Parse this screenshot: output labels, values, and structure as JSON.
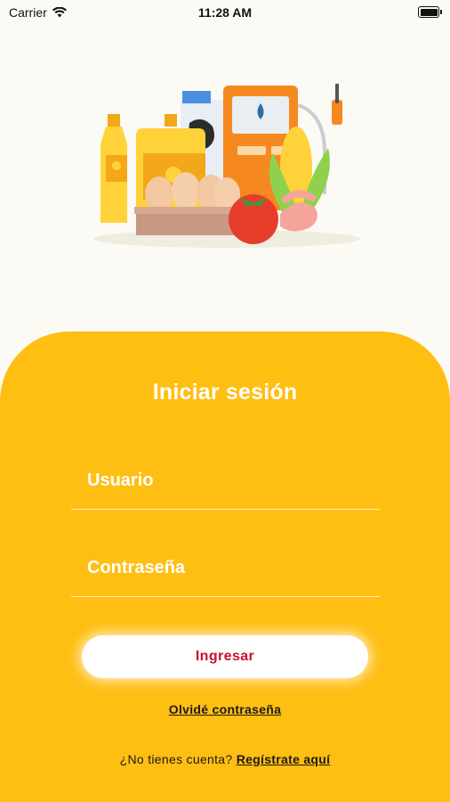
{
  "status_bar": {
    "carrier": "Carrier",
    "time": "11:28 AM"
  },
  "illustration": {
    "items": [
      "oil-bottle-icon",
      "oil-jug-icon",
      "milk-carton-icon",
      "fuel-pump-icon",
      "egg-tray-icon",
      "corn-icon",
      "tomato-icon",
      "shrimp-icon"
    ]
  },
  "login": {
    "title": "Iniciar sesión",
    "username_placeholder": "Usuario",
    "password_placeholder": "Contraseña",
    "submit_label": "Ingresar",
    "forgot_label": "Olvidé contraseña",
    "no_account_text": "¿No tienes cuenta?",
    "register_label": "Regístrate aquí"
  },
  "colors": {
    "accent": "#ffbe12",
    "button_text": "#c8102e",
    "background": "#fbfaf4"
  }
}
